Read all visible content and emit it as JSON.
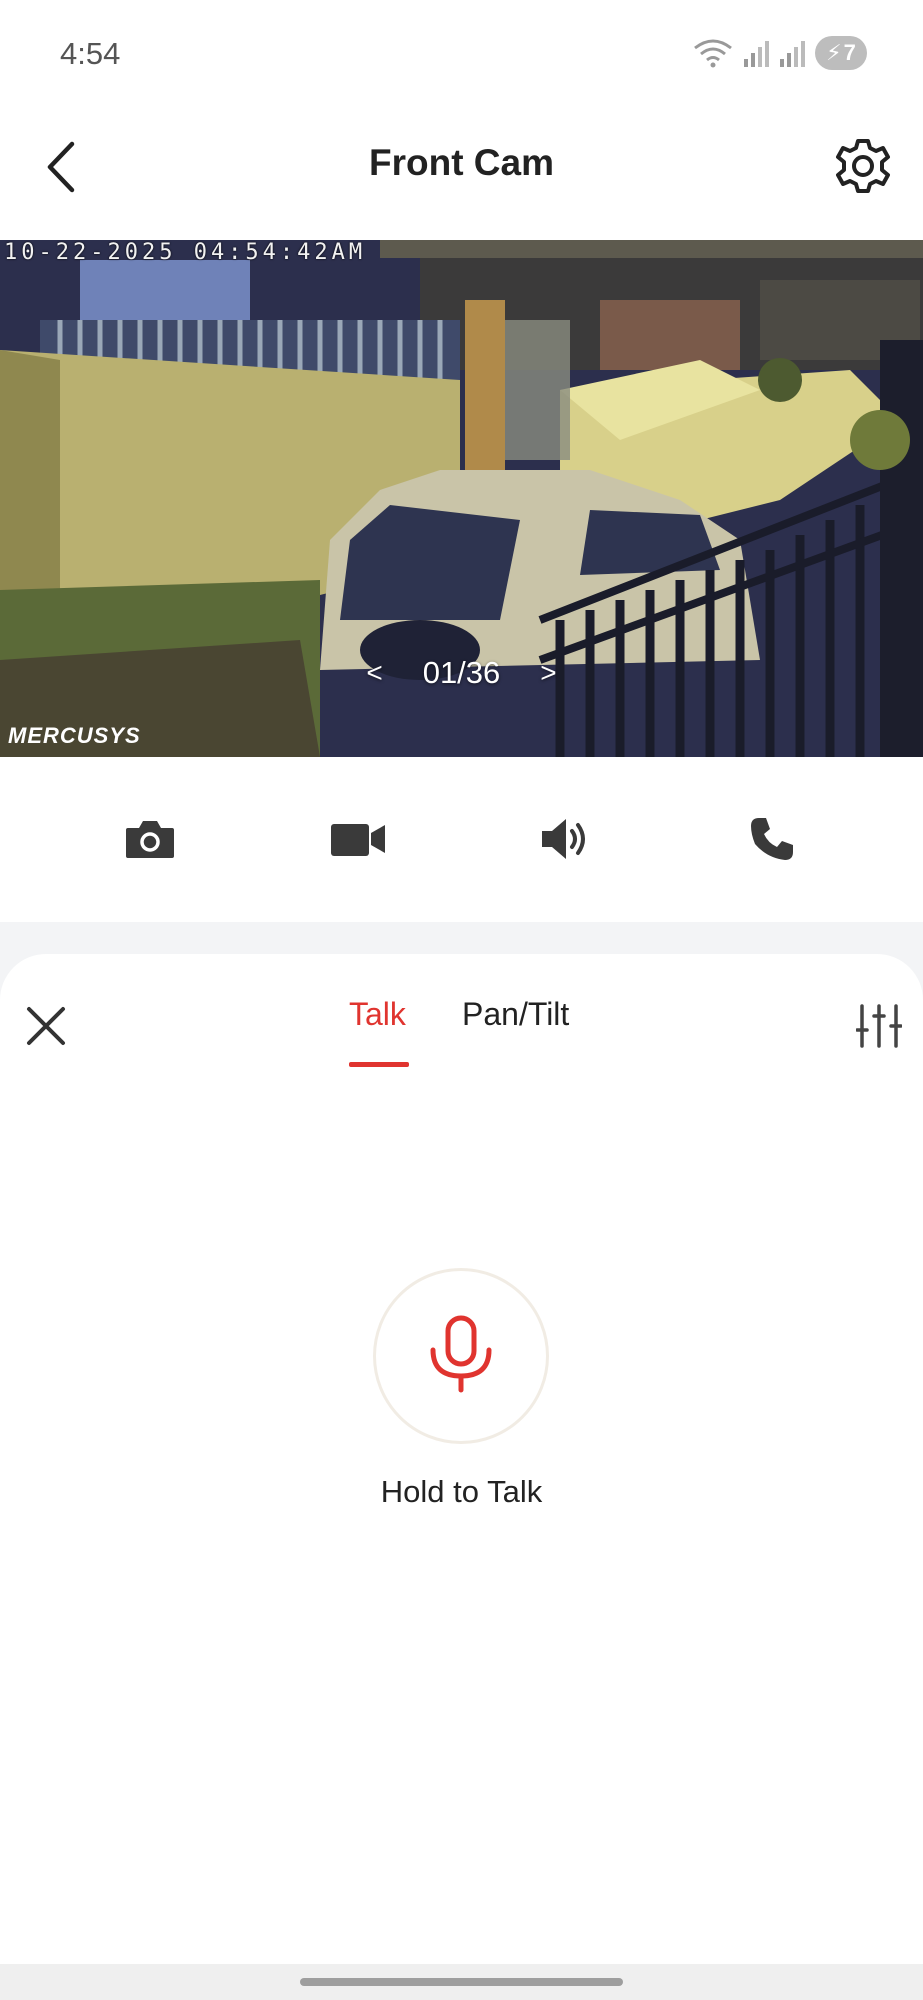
{
  "status_bar": {
    "time": "4:54",
    "battery_level": "7"
  },
  "header": {
    "title": "Front Cam",
    "back_icon": "chevron-left-icon",
    "settings_icon": "gear-icon"
  },
  "feed": {
    "timestamp": "10-22-2025 04:54:42AM",
    "counter": "01/36",
    "prev_label": "<",
    "next_label": ">",
    "brand": "MERCUSYS"
  },
  "controls": [
    {
      "icon": "camera-icon"
    },
    {
      "icon": "video-record-icon"
    },
    {
      "icon": "speaker-icon"
    },
    {
      "icon": "phone-icon"
    }
  ],
  "panel": {
    "tabs": [
      {
        "label": "Talk",
        "active": true
      },
      {
        "label": "Pan/Tilt",
        "active": false
      }
    ],
    "hold_to_talk": "Hold to Talk",
    "accent_color": "#e0342f"
  }
}
